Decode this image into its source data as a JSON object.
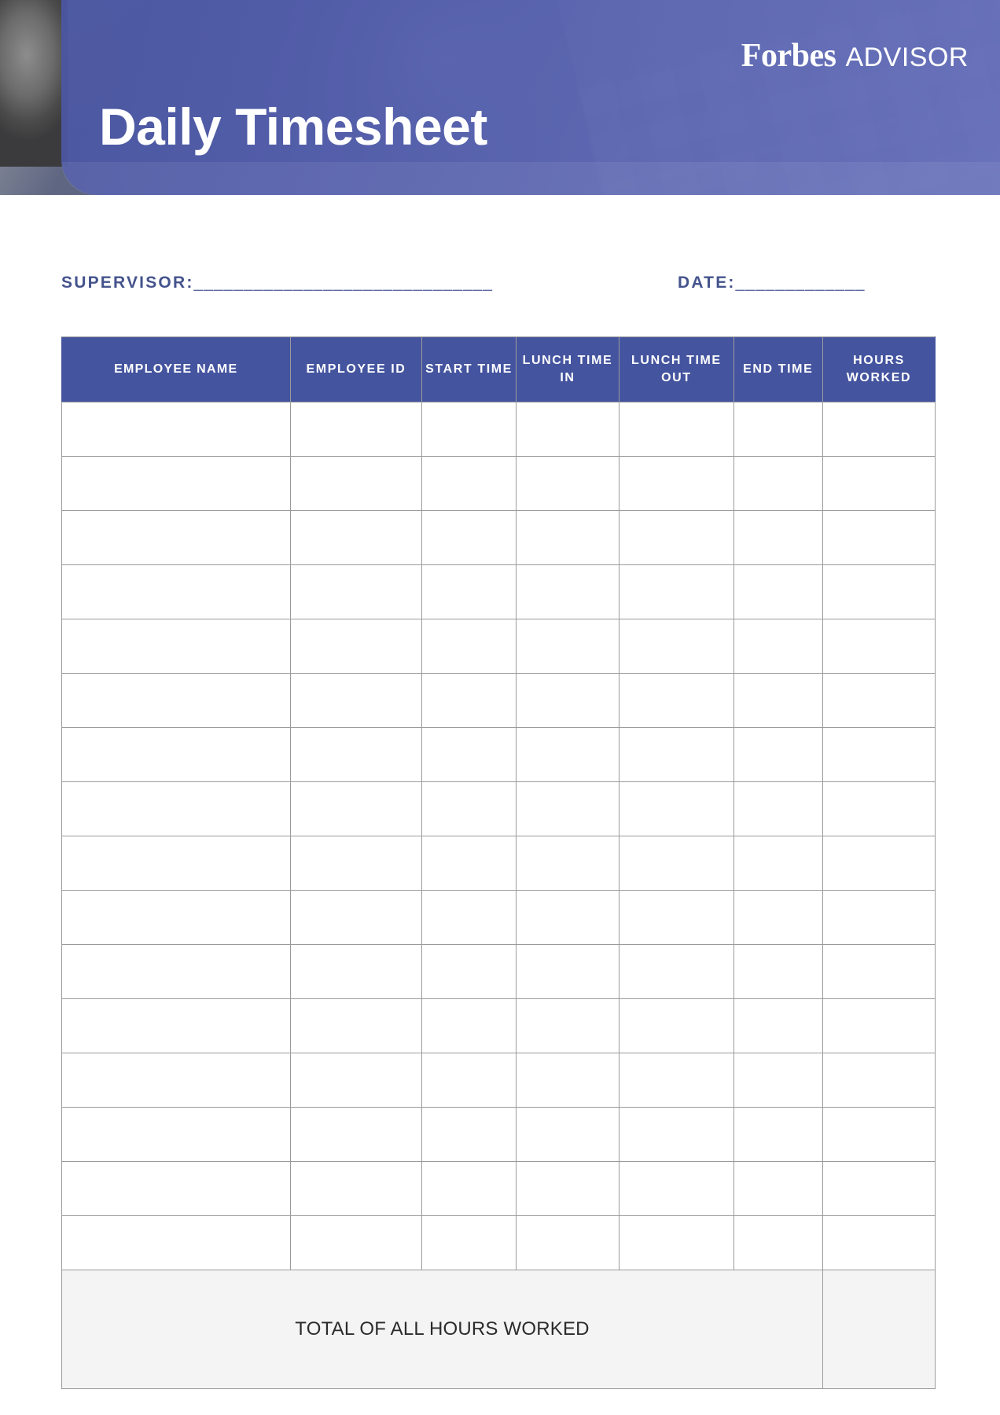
{
  "document": {
    "title": "Daily Timesheet",
    "brand": {
      "name": "Forbes",
      "product": "ADVISOR"
    },
    "accent_color": "#44549f",
    "header_text_color": "#ffffff",
    "label_color": "#44538c"
  },
  "meta": {
    "supervisor_label": "SUPERVISOR:",
    "supervisor_rule": "______________________________",
    "date_label": "DATE:",
    "date_rule": "_____________"
  },
  "table": {
    "columns": [
      "EMPLOYEE NAME",
      "EMPLOYEE ID",
      "START TIME",
      "LUNCH TIME IN",
      "LUNCH TIME OUT",
      "END TIME",
      "HOURS WORKED"
    ],
    "rows": [
      [
        "",
        "",
        "",
        "",
        "",
        "",
        ""
      ],
      [
        "",
        "",
        "",
        "",
        "",
        "",
        ""
      ],
      [
        "",
        "",
        "",
        "",
        "",
        "",
        ""
      ],
      [
        "",
        "",
        "",
        "",
        "",
        "",
        ""
      ],
      [
        "",
        "",
        "",
        "",
        "",
        "",
        ""
      ],
      [
        "",
        "",
        "",
        "",
        "",
        "",
        ""
      ],
      [
        "",
        "",
        "",
        "",
        "",
        "",
        ""
      ],
      [
        "",
        "",
        "",
        "",
        "",
        "",
        ""
      ],
      [
        "",
        "",
        "",
        "",
        "",
        "",
        ""
      ],
      [
        "",
        "",
        "",
        "",
        "",
        "",
        ""
      ],
      [
        "",
        "",
        "",
        "",
        "",
        "",
        ""
      ],
      [
        "",
        "",
        "",
        "",
        "",
        "",
        ""
      ],
      [
        "",
        "",
        "",
        "",
        "",
        "",
        ""
      ],
      [
        "",
        "",
        "",
        "",
        "",
        "",
        ""
      ],
      [
        "",
        "",
        "",
        "",
        "",
        "",
        ""
      ],
      [
        "",
        "",
        "",
        "",
        "",
        "",
        ""
      ]
    ],
    "footer": {
      "total_label": "TOTAL OF ALL HOURS WORKED",
      "total_value": ""
    }
  }
}
